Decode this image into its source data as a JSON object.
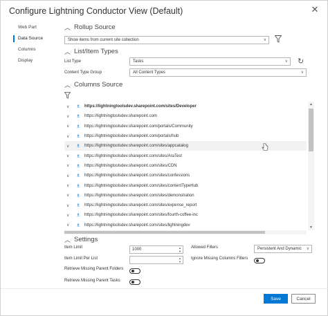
{
  "dialog": {
    "title": "Configure Lightning Conductor View (Default)",
    "close_icon": "✕"
  },
  "sidebar": {
    "items": [
      {
        "label": "Web Part",
        "active": false
      },
      {
        "label": "Data Source",
        "active": true
      },
      {
        "label": "Columns",
        "active": false
      },
      {
        "label": "Display",
        "active": false
      }
    ]
  },
  "rollup": {
    "header": "Rollup Source",
    "selected": "Show items from current site collection",
    "filter_icon": "filter-icon"
  },
  "list_types": {
    "header": "List/Item Types",
    "list_type_label": "List Type",
    "list_type_value": "Tasks",
    "content_type_group_label": "Content Type Group",
    "content_type_group_value": "All Content Types",
    "refresh_icon": "refresh-icon"
  },
  "columns_source": {
    "header": "Columns Source",
    "filter_icon": "filter-icon",
    "sites": [
      {
        "url": "https://lightningtoolsdev.sharepoint.com/sites/Developer",
        "bold": true
      },
      {
        "url": "https://lightningtoolsdev.sharepoint.com",
        "bold": false
      },
      {
        "url": "https://lightningtoolsdev.sharepoint.com/portals/Community",
        "bold": false
      },
      {
        "url": "https://lightningtoolsdev.sharepoint.com/portals/hub",
        "bold": false
      },
      {
        "url": "https://lightningtoolsdev.sharepoint.com/sites/appcatalog",
        "bold": false
      },
      {
        "url": "https://lightningtoolsdev.sharepoint.com/sites/AraTest",
        "bold": false
      },
      {
        "url": "https://lightningtoolsdev.sharepoint.com/sites/CDN",
        "bold": false
      },
      {
        "url": "https://lightningtoolsdev.sharepoint.com/sites/confessions",
        "bold": false
      },
      {
        "url": "https://lightningtoolsdev.sharepoint.com/sites/contentTypeHub",
        "bold": false
      },
      {
        "url": "https://lightningtoolsdev.sharepoint.com/sites/demonstration",
        "bold": false
      },
      {
        "url": "https://lightningtoolsdev.sharepoint.com/sites/expense_report",
        "bold": false
      },
      {
        "url": "https://lightningtoolsdev.sharepoint.com/sites/fourth-coffee-inc",
        "bold": false
      },
      {
        "url": "https://lightningtoolsdev.sharepoint.com/sites/lightningdev",
        "bold": false
      }
    ]
  },
  "settings": {
    "header": "Settings",
    "item_limit_label": "Item Limit",
    "item_limit_value": "1000",
    "item_limit_per_list_label": "Item Limit Per List",
    "item_limit_per_list_value": "",
    "retrieve_parent_folders_label": "Retrieve Missing Parent Folders",
    "retrieve_parent_tasks_label": "Retrieve Missing Parent Tasks",
    "allowed_filters_label": "Allowed Filters",
    "allowed_filters_value": "Persistent And Dynamic",
    "ignore_missing_columns_label": "Ignore Missing Columns Filters"
  },
  "footer": {
    "save_label": "Save",
    "cancel_label": "Cancel"
  },
  "colors": {
    "accent": "#0078d4"
  }
}
